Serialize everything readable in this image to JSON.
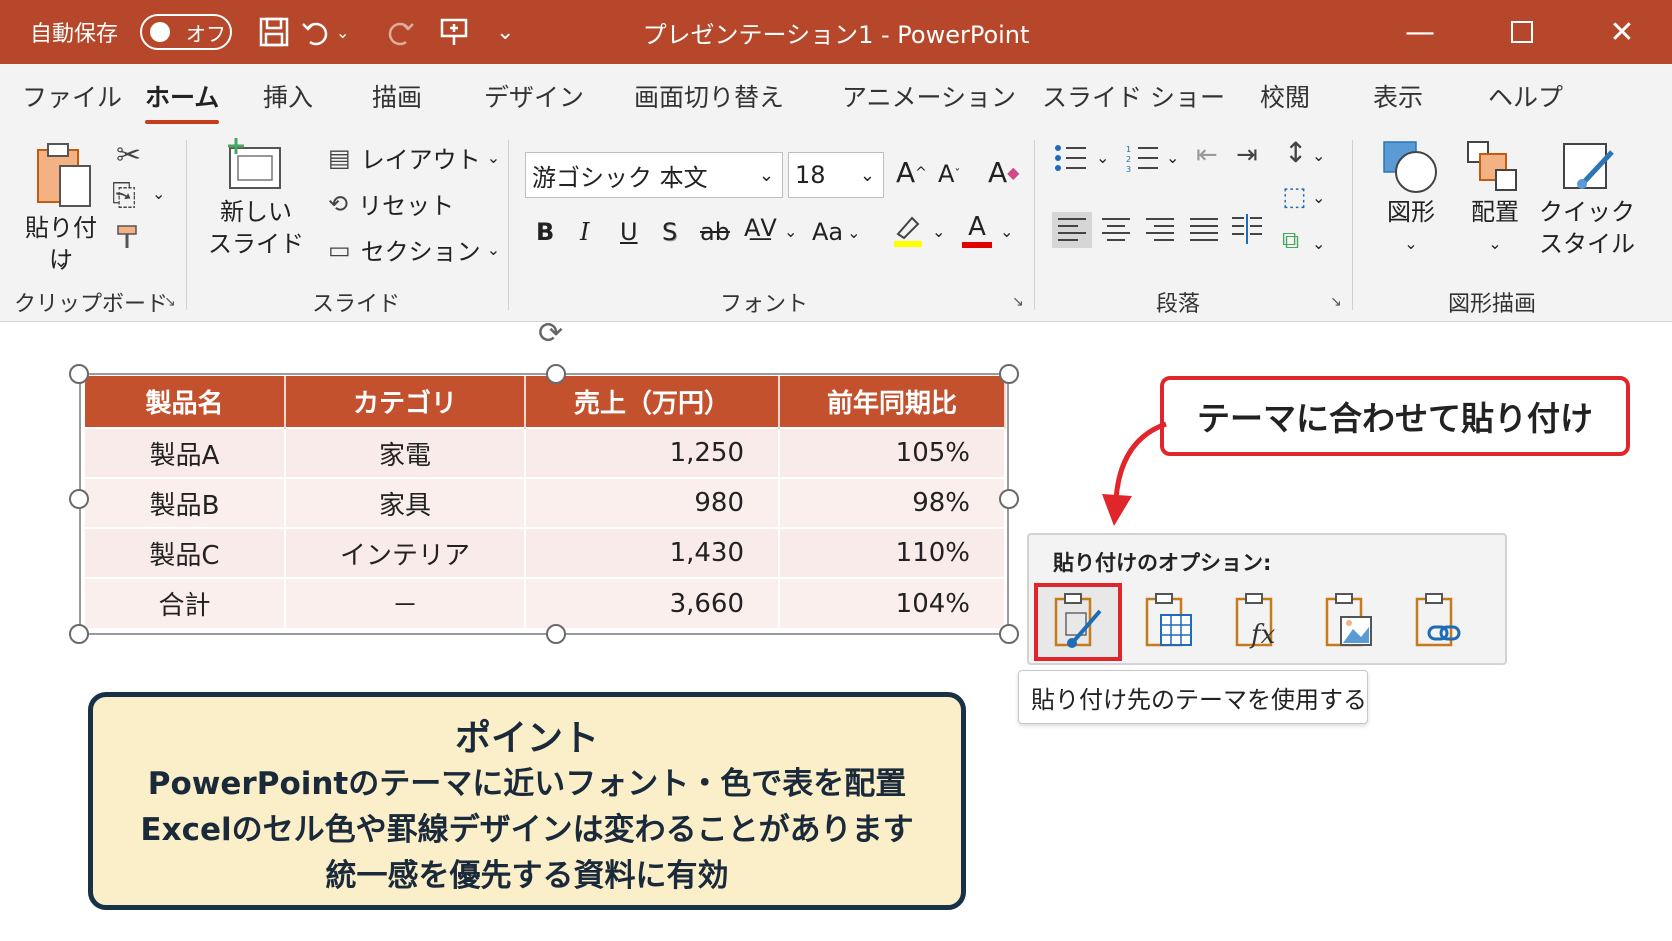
{
  "titlebar": {
    "autosave_label": "自動保存",
    "autosave_state": "オフ",
    "document_title": "プレゼンテーション1 - PowerPoint"
  },
  "tabs": [
    {
      "label": "ファイル"
    },
    {
      "label": "ホーム"
    },
    {
      "label": "挿入"
    },
    {
      "label": "描画"
    },
    {
      "label": "デザイン"
    },
    {
      "label": "画面切り替え"
    },
    {
      "label": "アニメーション"
    },
    {
      "label": "スライド ショー"
    },
    {
      "label": "校閲"
    },
    {
      "label": "表示"
    },
    {
      "label": "ヘルプ"
    }
  ],
  "ribbon": {
    "clipboard": {
      "group_label": "クリップボード",
      "paste_label": "貼り付け"
    },
    "slides": {
      "group_label": "スライド",
      "new_slide_line1": "新しい",
      "new_slide_line2": "スライド",
      "layout": "レイアウト",
      "reset": "リセット",
      "section": "セクション"
    },
    "font": {
      "group_label": "フォント",
      "font_name": "游ゴシック 本文",
      "font_size": "18",
      "case_label": "Aa"
    },
    "paragraph": {
      "group_label": "段落"
    },
    "drawing": {
      "group_label": "図形描画",
      "shapes_label": "図形",
      "arrange_label": "配置",
      "quick_style_line1": "クイック",
      "quick_style_line2": "スタイル"
    }
  },
  "table": {
    "headers": [
      "製品名",
      "カテゴリ",
      "売上（万円）",
      "前年同期比"
    ],
    "rows": [
      [
        "製品A",
        "家電",
        "1,250",
        "105%"
      ],
      [
        "製品B",
        "家具",
        "980",
        "98%"
      ],
      [
        "製品C",
        "インテリア",
        "1,430",
        "110%"
      ],
      [
        "合計",
        "－",
        "3,660",
        "104%"
      ]
    ]
  },
  "callout": {
    "text": "テーマに合わせて貼り付け"
  },
  "paste_options": {
    "title": "貼り付けのオプション:",
    "tooltip": "貼り付け先のテーマを使用する"
  },
  "point": {
    "title": "ポイント",
    "lines": [
      "PowerPointのテーマに近いフォント・色で表を配置",
      "Excelのセル色や罫線デザインは変わることがあります",
      "統一感を優先する資料に有効"
    ]
  },
  "colors": {
    "titlebar": "#b7472a",
    "accent_red": "#e0262a",
    "table_header": "#c4512e",
    "point_bg": "#fbefca"
  }
}
